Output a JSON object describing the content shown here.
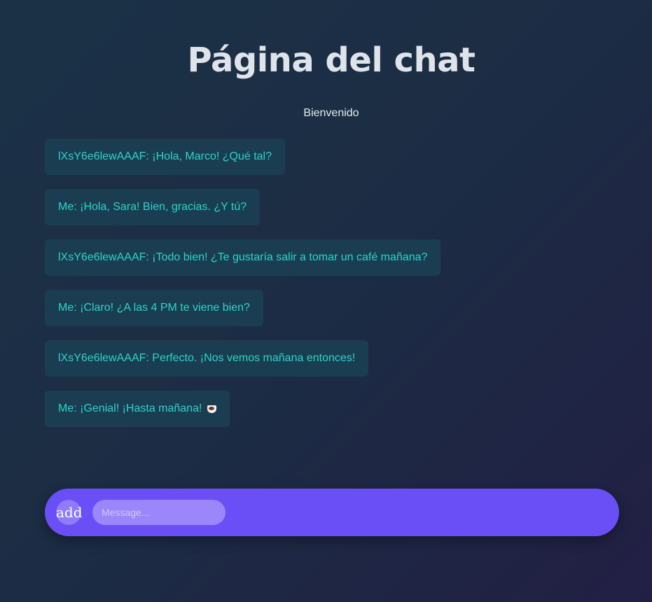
{
  "header": {
    "title": "Página del chat",
    "welcome": "Bienvenido"
  },
  "messages": [
    {
      "text": "lXsY6e6lewAAAF: ¡Hola, Marco! ¿Qué tal?"
    },
    {
      "text": "Me: ¡Hola, Sara! Bien, gracias. ¿Y tú?"
    },
    {
      "text": "lXsY6e6lewAAAF: ¡Todo bien! ¿Te gustaría salir a tomar un café mañana?"
    },
    {
      "text": "Me: ¡Claro! ¿A las 4 PM te viene bien?"
    },
    {
      "text": "lXsY6e6lewAAAF: Perfecto. ¡Nos vemos mañana entonces!"
    },
    {
      "text": "Me: ¡Genial! ¡Hasta mañana!",
      "emoji_icon": "coffee-icon"
    }
  ],
  "composer": {
    "add_label": "add",
    "input_value": "",
    "input_placeholder": "Message..."
  },
  "colors": {
    "message_text": "#2ad6c8",
    "bubble_bg": "#1b3d52",
    "composer_bg": "#6a4ff7"
  }
}
